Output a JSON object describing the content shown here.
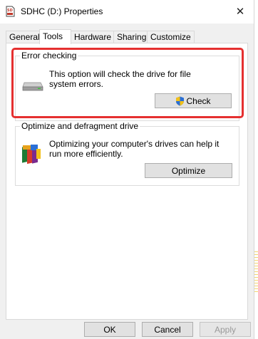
{
  "window": {
    "title": "SDHC (D:) Properties",
    "close_glyph": "✕",
    "icon_text": "SD"
  },
  "tabs": [
    {
      "label": "General",
      "active": false
    },
    {
      "label": "Tools",
      "active": true
    },
    {
      "label": "Hardware",
      "active": false
    },
    {
      "label": "Sharing",
      "active": false
    },
    {
      "label": "Customize",
      "active": false
    }
  ],
  "error_checking": {
    "group_label": "Error checking",
    "description": "This option will check the drive for file system errors.",
    "button_label": "Check",
    "highlight_color": "#e53030"
  },
  "optimize": {
    "group_label": "Optimize and defragment drive",
    "description": "Optimizing your computer's drives can help it run more efficiently.",
    "button_label": "Optimize"
  },
  "footer": {
    "ok_label": "OK",
    "cancel_label": "Cancel",
    "apply_label": "Apply"
  }
}
